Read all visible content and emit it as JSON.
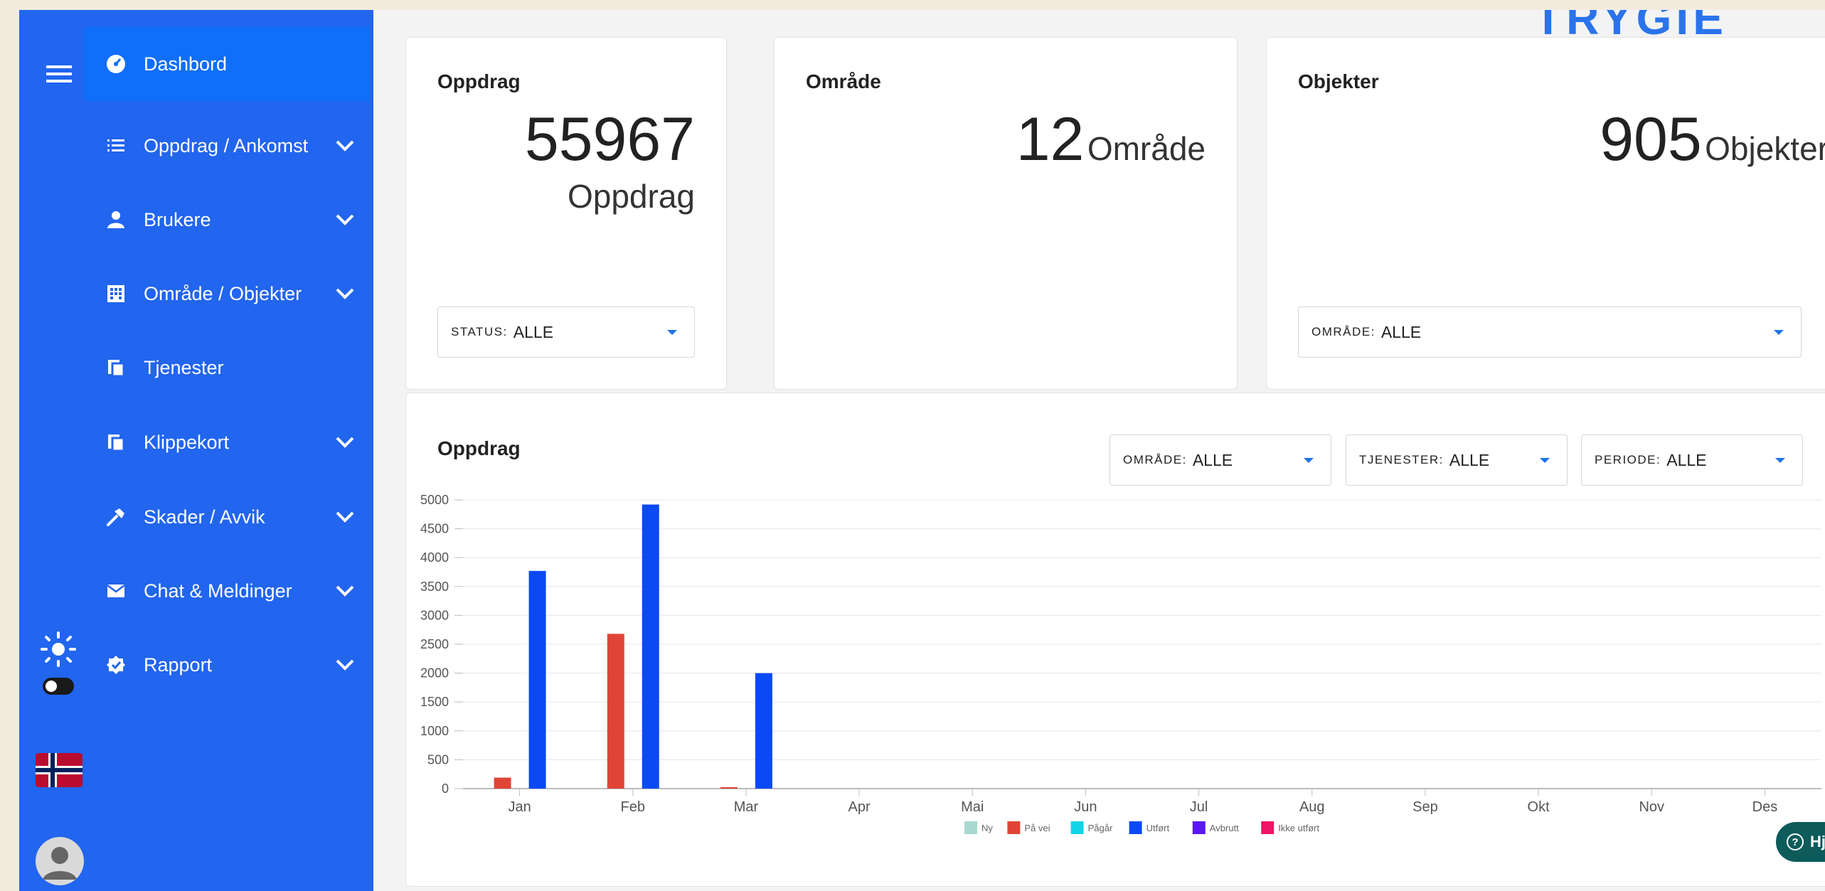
{
  "logo": {
    "text": "TRYGIE"
  },
  "sidebar": {
    "items": [
      {
        "label": "Dashbord",
        "icon": "dashboard-icon",
        "expandable": false,
        "active": true
      },
      {
        "label": "Oppdrag / Ankomst",
        "icon": "list-icon",
        "expandable": true
      },
      {
        "label": "Brukere",
        "icon": "person-icon",
        "expandable": true
      },
      {
        "label": "Område / Objekter",
        "icon": "building-icon",
        "expandable": true
      },
      {
        "label": "Tjenester",
        "icon": "copy-icon",
        "expandable": false
      },
      {
        "label": "Klippekort",
        "icon": "copy-icon",
        "expandable": true
      },
      {
        "label": "Skader / Avvik",
        "icon": "hammer-icon",
        "expandable": true
      },
      {
        "label": "Chat & Meldinger",
        "icon": "mail-icon",
        "expandable": true
      },
      {
        "label": "Rapport",
        "icon": "verified-icon",
        "expandable": true
      }
    ]
  },
  "cards": {
    "oppdrag": {
      "title": "Oppdrag",
      "value": "55967",
      "unit": "Oppdrag",
      "filter": {
        "key": "STATUS:",
        "value": "ALLE"
      }
    },
    "omrade": {
      "title": "Område",
      "value": "12",
      "unit": "Område"
    },
    "objekter": {
      "title": "Objekter",
      "value": "905",
      "unit": "Objekter",
      "filter": {
        "key": "OMRÅDE:",
        "value": "ALLE"
      }
    }
  },
  "chart_card": {
    "title": "Oppdrag",
    "filters": [
      {
        "key": "OMRÅDE:",
        "value": "ALLE"
      },
      {
        "key": "TJENESTER:",
        "value": "ALLE"
      },
      {
        "key": "PERIODE:",
        "value": "ALLE"
      }
    ]
  },
  "chart_data": {
    "type": "bar",
    "categories": [
      "Jan",
      "Feb",
      "Mar",
      "Apr",
      "Mai",
      "Jun",
      "Jul",
      "Aug",
      "Sep",
      "Okt",
      "Nov",
      "Des"
    ],
    "series": [
      {
        "name": "Ny",
        "color": "#a8d8d0",
        "values": [
          0,
          0,
          0,
          0,
          0,
          0,
          0,
          0,
          0,
          0,
          0,
          0
        ]
      },
      {
        "name": "På vei",
        "color": "#df4437",
        "values": [
          190,
          2680,
          25,
          0,
          0,
          0,
          0,
          0,
          0,
          0,
          0,
          0
        ]
      },
      {
        "name": "Pågår",
        "color": "#11d3e6",
        "values": [
          0,
          0,
          0,
          0,
          0,
          0,
          0,
          0,
          0,
          0,
          0,
          0
        ]
      },
      {
        "name": "Utført",
        "color": "#0b49f5",
        "values": [
          3770,
          4920,
          2000,
          0,
          0,
          0,
          0,
          0,
          0,
          0,
          0,
          0
        ]
      },
      {
        "name": "Avbrutt",
        "color": "#5a17f0",
        "values": [
          0,
          0,
          0,
          0,
          0,
          0,
          0,
          0,
          0,
          0,
          0,
          0
        ]
      },
      {
        "name": "Ikke utført",
        "color": "#f01366",
        "values": [
          0,
          0,
          0,
          0,
          0,
          0,
          0,
          0,
          0,
          0,
          0,
          0
        ]
      }
    ],
    "ylim": [
      0,
      5000
    ],
    "yticks": [
      0,
      500,
      1000,
      1500,
      2000,
      2500,
      3000,
      3500,
      4000,
      4500,
      5000
    ],
    "grid": true,
    "legend": "bottom"
  },
  "help": {
    "label": "Hjelp"
  },
  "colors": {
    "sidebar": "#2265ee",
    "active_item": "#0f6ffb",
    "accent": "#1e73e8"
  }
}
